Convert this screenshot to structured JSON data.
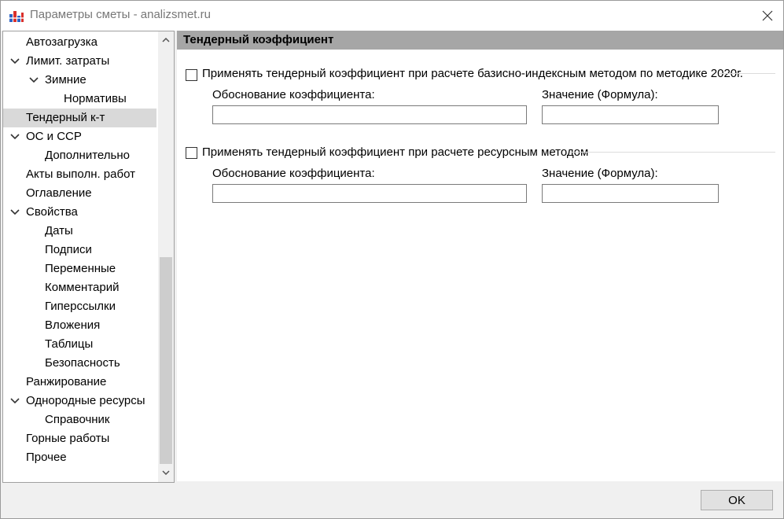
{
  "window": {
    "title": "Параметры сметы - analizsmet.ru",
    "close_icon": "close-icon",
    "app_icon": "app-icon"
  },
  "sidebar": {
    "items": [
      {
        "label": "Автозагрузка",
        "level": 0,
        "expander": false
      },
      {
        "label": "Лимит. затраты",
        "level": 0,
        "expander": true
      },
      {
        "label": "Зимние",
        "level": 1,
        "expander": true
      },
      {
        "label": "Нормативы",
        "level": 2,
        "expander": false
      },
      {
        "label": "Тендерный к-т",
        "level": 0,
        "expander": false,
        "selected": true
      },
      {
        "label": "ОС и ССР",
        "level": 0,
        "expander": true
      },
      {
        "label": "Дополнительно",
        "level": 1,
        "expander": false
      },
      {
        "label": "Акты выполн. работ",
        "level": 0,
        "expander": false
      },
      {
        "label": "Оглавление",
        "level": 0,
        "expander": false
      },
      {
        "label": "Свойства",
        "level": 0,
        "expander": true
      },
      {
        "label": "Даты",
        "level": 1,
        "expander": false
      },
      {
        "label": "Подписи",
        "level": 1,
        "expander": false
      },
      {
        "label": "Переменные",
        "level": 1,
        "expander": false
      },
      {
        "label": "Комментарий",
        "level": 1,
        "expander": false
      },
      {
        "label": "Гиперссылки",
        "level": 1,
        "expander": false
      },
      {
        "label": "Вложения",
        "level": 1,
        "expander": false
      },
      {
        "label": "Таблицы",
        "level": 1,
        "expander": false
      },
      {
        "label": "Безопасность",
        "level": 1,
        "expander": false
      },
      {
        "label": "Ранжирование",
        "level": 0,
        "expander": false
      },
      {
        "label": "Однородные ресурсы",
        "level": 0,
        "expander": true
      },
      {
        "label": "Справочник",
        "level": 1,
        "expander": false
      },
      {
        "label": "Горные работы",
        "level": 0,
        "expander": false
      },
      {
        "label": "Прочее",
        "level": 0,
        "expander": false
      }
    ]
  },
  "main": {
    "section_title": "Тендерный коэффициент",
    "group1": {
      "checkbox_label": "Применять тендерный коэффициент при расчете базисно-индексным методом по методике 2020г.",
      "checked": false,
      "justification_label": "Обоснование коэффициента:",
      "justification_value": "",
      "value_label": "Значение (Формула):",
      "value_value": ""
    },
    "group2": {
      "checkbox_label": "Применять тендерный коэффициент при расчете ресурсным методом",
      "checked": false,
      "justification_label": "Обоснование коэффициента:",
      "justification_value": "",
      "value_label": "Значение (Формула):",
      "value_value": ""
    }
  },
  "footer": {
    "ok_label": "OK"
  },
  "colors": {
    "section_header_bg": "#a6a6a6",
    "selected_item_bg": "#d9d9d9",
    "window_bg": "#f0f0f0"
  }
}
